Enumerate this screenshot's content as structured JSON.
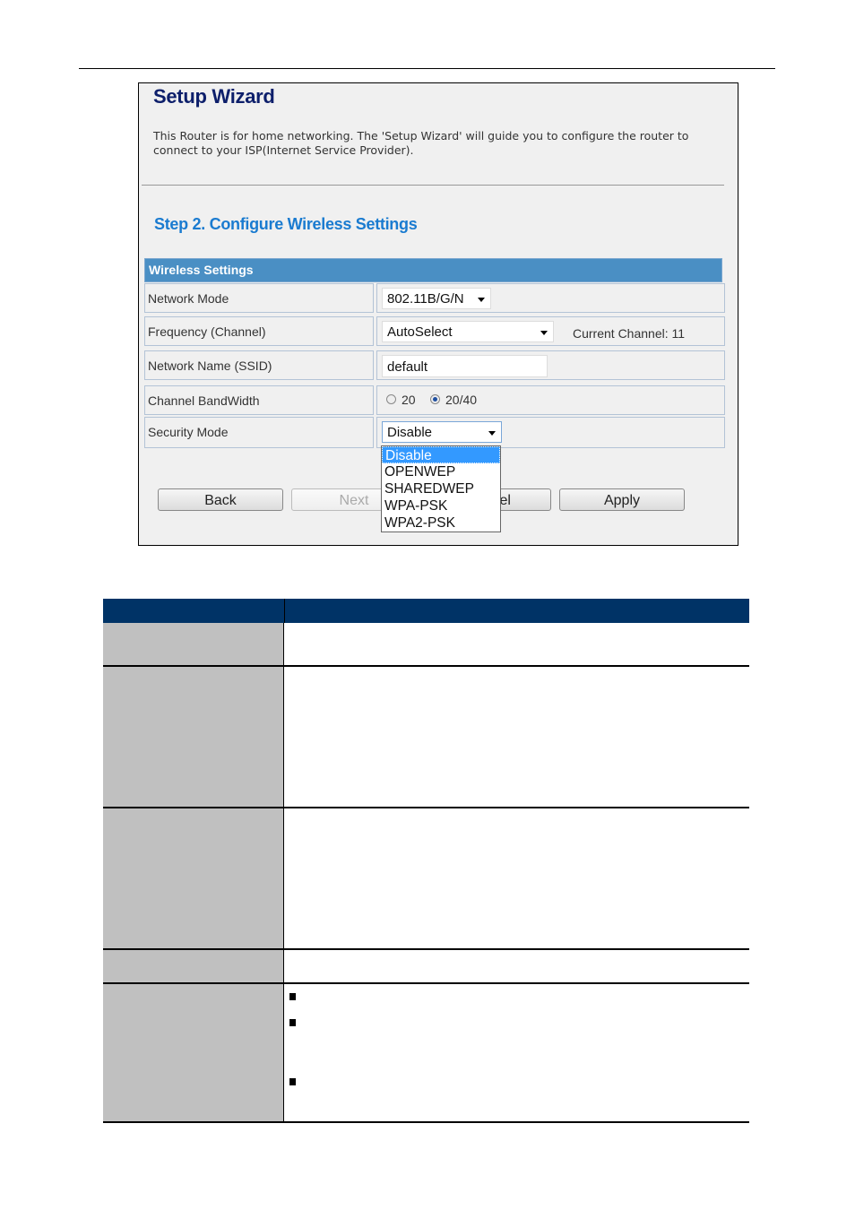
{
  "screenshot": {
    "title": "Setup Wizard",
    "intro": "This Router is for home networking. The 'Setup Wizard' will guide you to configure the router to connect to your ISP(Internet Service Provider).",
    "step_title": "Step 2. Configure Wireless Settings",
    "section_header": "Wireless Settings",
    "fields": {
      "network_mode": {
        "label": "Network Mode",
        "value": "802.11B/G/N"
      },
      "frequency": {
        "label": "Frequency (Channel)",
        "value": "AutoSelect",
        "current_channel": "Current Channel: 11"
      },
      "ssid": {
        "label": "Network Name (SSID)",
        "value": "default"
      },
      "bandwidth": {
        "label": "Channel BandWidth",
        "options": [
          "20",
          "20/40"
        ],
        "selected": "20/40"
      },
      "security": {
        "label": "Security Mode",
        "value": "Disable",
        "options": [
          "Disable",
          "OPENWEP",
          "SHAREDWEP",
          "WPA-PSK",
          "WPA2-PSK"
        ],
        "highlighted": "Disable"
      }
    },
    "buttons": {
      "back": "Back",
      "next": "Next",
      "cancel": "Cancel",
      "apply": "Apply"
    }
  },
  "table": {
    "header_color": "#003366",
    "label_cell_color": "#c0c0c0",
    "rows": 5,
    "bullets_in_last_row": 3
  }
}
